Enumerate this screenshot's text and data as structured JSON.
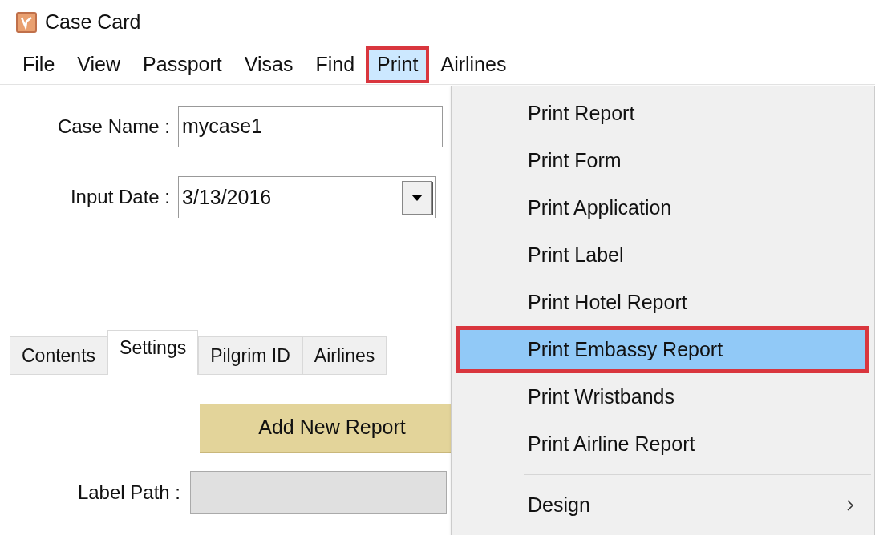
{
  "window": {
    "title": "Case Card"
  },
  "menu_bar": [
    {
      "label": "File",
      "selected": false,
      "annotated": false
    },
    {
      "label": "View",
      "selected": false,
      "annotated": false
    },
    {
      "label": "Passport",
      "selected": false,
      "annotated": false
    },
    {
      "label": "Visas",
      "selected": false,
      "annotated": false
    },
    {
      "label": "Find",
      "selected": false,
      "annotated": false
    },
    {
      "label": "Print",
      "selected": true,
      "annotated": true
    },
    {
      "label": "Airlines",
      "selected": false,
      "annotated": false
    }
  ],
  "form": {
    "case_name": {
      "label": "Case Name :",
      "value": "mycase1"
    },
    "input_date": {
      "label": "Input Date :",
      "value": "3/13/2016"
    }
  },
  "tabs": [
    {
      "label": "Contents",
      "selected": false
    },
    {
      "label": "Settings",
      "selected": true
    },
    {
      "label": "Pilgrim ID",
      "selected": false
    },
    {
      "label": "Airlines",
      "selected": false
    }
  ],
  "settings": {
    "add_button": "Add New Report",
    "label_path": {
      "label": "Label Path :"
    }
  },
  "print_menu": [
    {
      "kind": "item",
      "label": "Print Report",
      "selected": false,
      "annotated": false
    },
    {
      "kind": "item",
      "label": "Print Form",
      "selected": false,
      "annotated": false
    },
    {
      "kind": "item",
      "label": "Print Application",
      "selected": false,
      "annotated": false
    },
    {
      "kind": "item",
      "label": "Print Label",
      "selected": false,
      "annotated": false
    },
    {
      "kind": "item",
      "label": "Print Hotel Report",
      "selected": false,
      "annotated": false
    },
    {
      "kind": "item",
      "label": "Print Embassy Report",
      "selected": true,
      "annotated": true
    },
    {
      "kind": "item",
      "label": "Print Wristbands",
      "selected": false,
      "annotated": false
    },
    {
      "kind": "item",
      "label": "Print Airline Report",
      "selected": false,
      "annotated": false
    },
    {
      "kind": "separator"
    },
    {
      "kind": "submenu",
      "label": "Design",
      "selected": false,
      "annotated": false
    }
  ]
}
